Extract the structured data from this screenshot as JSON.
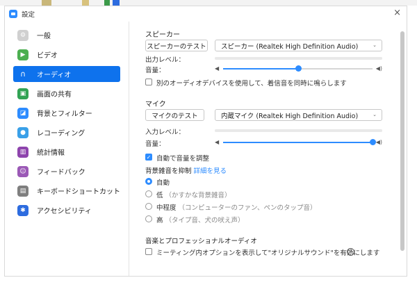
{
  "window": {
    "title": "設定",
    "close_symbol": "×"
  },
  "colors": {
    "accent": "#0e72ed",
    "slider": "#2d8cff",
    "active_text": "#ffffff"
  },
  "sidebar": {
    "items": [
      {
        "label": "一般",
        "icon": "gear-icon",
        "color": "#bdbdbd",
        "active": false
      },
      {
        "label": "ビデオ",
        "icon": "video-icon",
        "color": "#4caf50",
        "active": false
      },
      {
        "label": "オーディオ",
        "icon": "headphones-icon",
        "color": "#0e72ed",
        "active": true
      },
      {
        "label": "画面の共有",
        "icon": "share-screen-icon",
        "color": "#31a354",
        "active": false
      },
      {
        "label": "背景とフィルター",
        "icon": "background-icon",
        "color": "#2d8cff",
        "active": false
      },
      {
        "label": "レコーディング",
        "icon": "record-icon",
        "color": "#3aa0e8",
        "active": false
      },
      {
        "label": "統計情報",
        "icon": "statistics-icon",
        "color": "#8e44ad",
        "active": false
      },
      {
        "label": "フィードバック",
        "icon": "feedback-icon",
        "color": "#9b59b6",
        "active": false
      },
      {
        "label": "キーボードショートカット",
        "icon": "keyboard-icon",
        "color": "#7f7f7f",
        "active": false
      },
      {
        "label": "アクセシビリティ",
        "icon": "accessibility-icon",
        "color": "#2d6cdf",
        "active": false
      }
    ]
  },
  "speaker": {
    "section_title": "スピーカー",
    "test_button": "スピーカーのテスト",
    "device": "スピーカー (Realtek High Definition Audio)",
    "output_level_label": "出力レベル：",
    "volume_label": "音量：",
    "volume_fraction": 0.5,
    "separate_device_label": "別のオーディオデバイスを使用して、着信音を同時に鳴らします"
  },
  "mic": {
    "section_title": "マイク",
    "test_button": "マイクのテスト",
    "device": "内蔵マイク (Realtek High Definition Audio)",
    "input_level_label": "入力レベル：",
    "volume_label": "音量：",
    "volume_fraction": 1.0,
    "auto_adjust_label": "自動で音量を調整"
  },
  "noise": {
    "title": "背景雑音を抑制",
    "learn_more": "詳細を見る",
    "options": [
      {
        "label": "自動",
        "hint": "",
        "checked": true
      },
      {
        "label": "低",
        "hint": "（かすかな背景雑音）",
        "checked": false
      },
      {
        "label": "中程度",
        "hint": "（コンピューターのファン、ペンのタップ音）",
        "checked": false
      },
      {
        "label": "高",
        "hint": "（タイプ音、犬の吠え声）",
        "checked": false
      }
    ]
  },
  "music": {
    "title": "音楽とプロフェッショナルオーディオ",
    "original_sound_label": "ミーティング内オプションを表示して\"オリジナルサウンド\"を有効にします"
  }
}
